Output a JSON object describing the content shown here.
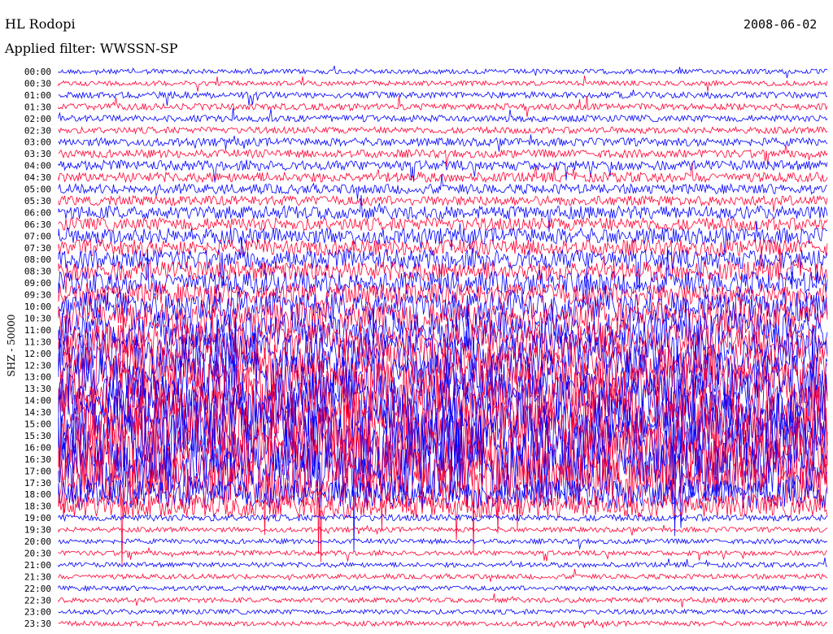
{
  "header": {
    "station": "HL Rodopi",
    "filter": "Applied filter: WWSSN-SP",
    "date": "2008-06-02"
  },
  "chart_data": {
    "type": "line",
    "title": "HL Rodopi",
    "ylabel": "SHZ - 50000",
    "colors": [
      "#0000ff",
      "#ff0033"
    ],
    "row_labels": [
      "00:00",
      "00:30",
      "01:00",
      "01:30",
      "02:00",
      "02:30",
      "03:00",
      "03:30",
      "04:00",
      "04:30",
      "05:00",
      "05:30",
      "06:00",
      "06:30",
      "07:00",
      "07:30",
      "08:00",
      "08:30",
      "09:00",
      "09:30",
      "10:00",
      "10:30",
      "11:00",
      "11:30",
      "12:00",
      "12:30",
      "13:00",
      "13:30",
      "14:00",
      "14:30",
      "15:00",
      "15:30",
      "16:00",
      "16:30",
      "17:00",
      "17:30",
      "18:00",
      "18:30",
      "19:00",
      "19:30",
      "20:00",
      "20:30",
      "21:00",
      "21:30",
      "22:00",
      "22:30",
      "23:00",
      "23:30"
    ],
    "row_amplitude": [
      3,
      3,
      4,
      4,
      4,
      4,
      5,
      5,
      6,
      6,
      6,
      6,
      8,
      8,
      10,
      10,
      12,
      12,
      14,
      14,
      18,
      20,
      22,
      22,
      26,
      28,
      30,
      32,
      34,
      36,
      38,
      40,
      40,
      38,
      36,
      30,
      18,
      14,
      4,
      3,
      3,
      3,
      3,
      3,
      3,
      3,
      3,
      3
    ]
  }
}
